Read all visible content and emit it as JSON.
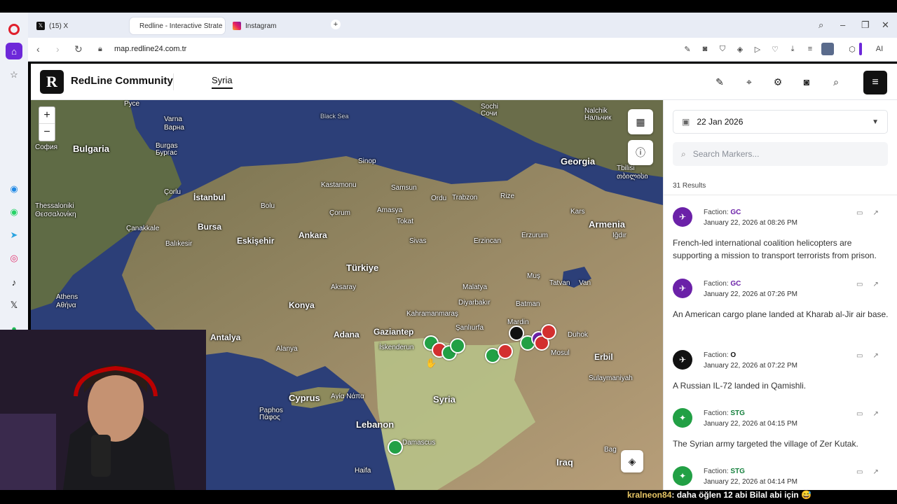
{
  "browser": {
    "tabs": [
      {
        "label": "(15) X",
        "icon": "x-logo-icon"
      },
      {
        "label": "Redline - Interactive Strate",
        "icon": "redline-logo-icon"
      },
      {
        "label": "Instagram",
        "icon": "instagram-icon"
      }
    ],
    "url": "map.redline24.com.tr",
    "ai_label": "AI"
  },
  "app": {
    "brand_letter": "R",
    "brand_name": "RedLine Community",
    "region_tab": "Syria"
  },
  "map": {
    "zoom_in": "+",
    "zoom_out": "−",
    "labels": {
      "black_sea": "Black Sea",
      "varna": "Varna",
      "varna_cyr": "Варна",
      "sofia": "София",
      "bulgaria": "Bulgaria",
      "burgas": "Burgas",
      "burgas_cyr": "Бургас",
      "ruse": "Русе",
      "sochi": "Sochi",
      "sochi_cyr": "Сочи",
      "nalchik": "Nalchik",
      "nalchik_cyr": "Нальчик",
      "georgia": "Georgia",
      "tbilisi": "Tbilisi",
      "tbilisi_geo": "თბილისი",
      "sinop": "Sinop",
      "samsun": "Samsun",
      "kastamonu": "Kastamonu",
      "istanbul": "İstanbul",
      "bolu": "Bolu",
      "ordu": "Ordu",
      "trabzon": "Trabzon",
      "rize": "Rize",
      "kars": "Kars",
      "thessaloniki": "Thessaloniki",
      "thessaloniki_gr": "Θεσσαλονίκη",
      "corlu": "Çorlu",
      "bursa": "Bursa",
      "corum": "Çorum",
      "amasya": "Amasya",
      "tokat": "Tokat",
      "armenia": "Armenia",
      "canakkale": "Çanakkale",
      "eskisehir": "Eskişehir",
      "ankara": "Ankara",
      "sivas": "Sivas",
      "erzincan": "Erzincan",
      "erzurum": "Erzurum",
      "igdir": "Iğdır",
      "balikesir": "Balıkesir",
      "turkiye": "Türkiye",
      "malatya": "Malatya",
      "mus": "Muş",
      "tatvan": "Tatvan",
      "van": "Van",
      "athens": "Athens",
      "athens_gr": "Αθήνα",
      "aksaray": "Aksaray",
      "konya": "Konya",
      "diyarbakir": "Diyarbakır",
      "batman": "Batman",
      "kahramanmaras": "Kahramanmaraş",
      "sanliurfa": "Şanlıurfa",
      "mardin": "Mardin",
      "adana": "Adana",
      "gaziantep": "Gaziantep",
      "antalya": "Antalya",
      "duhok": "Duhok",
      "iskenderun": "İskenderun",
      "mosul": "Mosul",
      "erbil": "Erbil",
      "alanya": "Alanya",
      "sulaymaniyah": "Sulaymaniyah",
      "cyprus": "Cyprus",
      "ayia_napa": "Αγία Νάπα",
      "syria": "Syria",
      "paphos": "Paphos",
      "paphos_gr": "Πάφος",
      "lebanon": "Lebanon",
      "damascus": "Damascus",
      "iraq": "Iraq",
      "haifa": "Haifa",
      "baghdad": "Bag"
    }
  },
  "panel": {
    "date": "22 Jan 2026",
    "search_placeholder": "Search Markers...",
    "results": "31 Results",
    "faction_prefix": "Faction:",
    "entries": [
      {
        "faction": "GC",
        "faction_color": "#6b21a8",
        "timestamp": "January 22, 2026 at 08:26 PM",
        "text": "French-led international coalition helicopters are supporting a mission to transport terrorists from prison.",
        "icon": "helicopter-icon",
        "avatar_color": "#6b21a8"
      },
      {
        "faction": "GC",
        "faction_color": "#6b21a8",
        "timestamp": "January 22, 2026 at 07:26 PM",
        "text": "An American cargo plane landed at Kharab al-Jir air base.",
        "icon": "plane-icon",
        "avatar_color": "#6b21a8"
      },
      {
        "faction": "O",
        "faction_color": "#111111",
        "timestamp": "January 22, 2026 at 07:22 PM",
        "text": "A Russian IL-72 landed in Qamishli.",
        "icon": "plane-icon",
        "avatar_color": "#111111"
      },
      {
        "faction": "STG",
        "faction_color": "#15803d",
        "timestamp": "January 22, 2026 at 04:15 PM",
        "text": "The Syrian army targeted the village of Zer Kutak.",
        "icon": "artillery-icon",
        "avatar_color": "#22a045"
      },
      {
        "faction": "STG",
        "faction_color": "#15803d",
        "timestamp": "January 22, 2026 at 04:14 PM",
        "text": "",
        "icon": "artillery-icon",
        "avatar_color": "#22a045"
      }
    ]
  },
  "overlay": {
    "chat_user": "kralneon84",
    "chat_message": ": daha öğlen 12 abi Bilal abi için 😅"
  }
}
